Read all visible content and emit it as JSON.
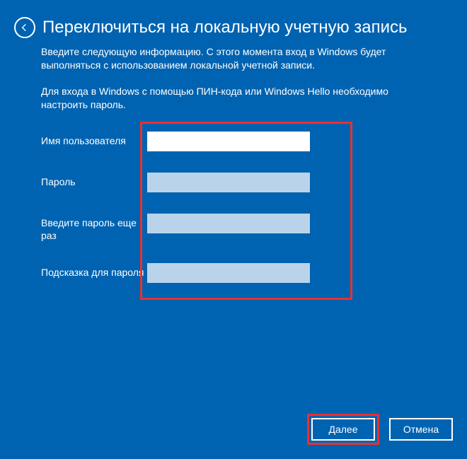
{
  "header": {
    "title": "Переключиться на локальную учетную запись"
  },
  "description1": "Введите следующую информацию. С этого момента вход в Windows будет выполняться с использованием локальной учетной записи.",
  "description2": "Для входа в Windows с помощью ПИН-кода или Windows Hello необходимо настроить пароль.",
  "form": {
    "username": {
      "label": "Имя пользователя",
      "value": ""
    },
    "password": {
      "label": "Пароль",
      "value": ""
    },
    "confirm": {
      "label": "Введите пароль еще раз",
      "value": ""
    },
    "hint": {
      "label": "Подсказка для пароля",
      "value": ""
    }
  },
  "buttons": {
    "next": "Далее",
    "cancel": "Отмена"
  }
}
